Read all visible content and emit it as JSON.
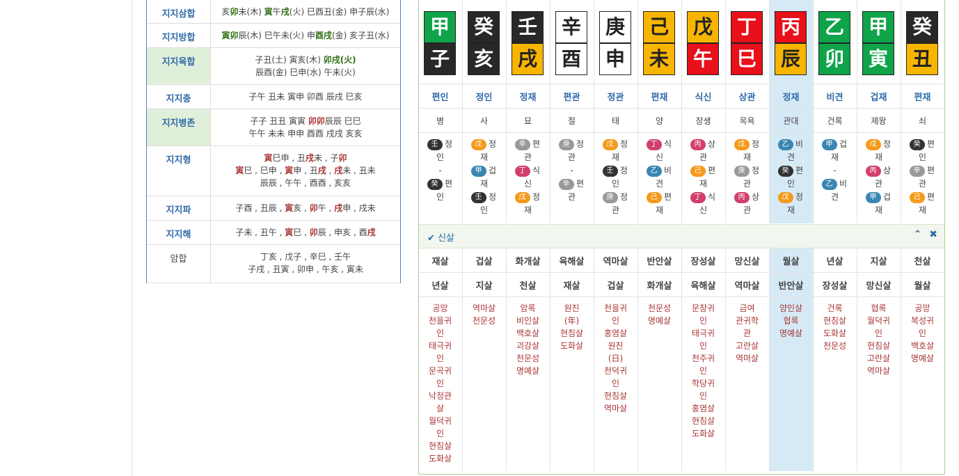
{
  "left": [
    {
      "label": "지지삼합",
      "style": "blue",
      "lines": [
        [
          [
            "亥",
            ""
          ],
          [
            "卯",
            "g"
          ],
          [
            "未(木) ",
            ""
          ],
          [
            "寅",
            "g"
          ],
          [
            "午",
            ""
          ],
          [
            "戌",
            "g"
          ],
          [
            "(火) 巳酉丑(金) 申子辰(水)",
            ""
          ]
        ]
      ]
    },
    {
      "label": "지지방합",
      "style": "blue",
      "lines": [
        [
          [
            "寅",
            "g"
          ],
          [
            "卯",
            "g"
          ],
          [
            "辰(木) 巳午未(火) 申",
            ""
          ],
          [
            "酉",
            "g"
          ],
          [
            "戌",
            "g"
          ],
          [
            "(金) 亥子丑(水)",
            ""
          ]
        ]
      ]
    },
    {
      "label": "지지육합",
      "style": "green",
      "lines": [
        [
          [
            "子丑(土) 寅亥(木) ",
            ""
          ],
          [
            "卯戌(火)",
            "g"
          ]
        ],
        [
          [
            "辰酉(金) 巳申(水) 午未(火)",
            ""
          ]
        ]
      ]
    },
    {
      "label": "지지충",
      "style": "blue",
      "lines": [
        [
          [
            "子午 丑未 寅申 卯酉 辰戌 巳亥",
            ""
          ]
        ]
      ]
    },
    {
      "label": "지지병존",
      "style": "green",
      "lines": [
        [
          [
            "子子 丑丑 寅寅 ",
            ""
          ],
          [
            "卯卯",
            "r"
          ],
          [
            "辰辰 巳巳",
            ""
          ]
        ],
        [
          [
            "午午 未未 申申 酉酉 戌戌 亥亥",
            ""
          ]
        ]
      ]
    },
    {
      "label": "지지형",
      "style": "blue",
      "lines": [
        [
          [
            "寅",
            "r"
          ],
          [
            "巳申 , 丑",
            ""
          ],
          [
            "戌",
            "r"
          ],
          [
            "未 , 子",
            ""
          ],
          [
            "卯",
            "r"
          ]
        ],
        [
          [
            "寅",
            "r"
          ],
          [
            "巳 , 巳申 , ",
            ""
          ],
          [
            "寅",
            "r"
          ],
          [
            "申 , 丑",
            ""
          ],
          [
            "戌",
            "r"
          ],
          [
            " , ",
            ""
          ],
          [
            "戌",
            "r"
          ],
          [
            "未 , 丑未",
            ""
          ]
        ],
        [
          [
            "辰辰 , 午午 , 酉酉 , 亥亥",
            ""
          ]
        ]
      ]
    },
    {
      "label": "지지파",
      "style": "blue",
      "lines": [
        [
          [
            "子酉 , 丑辰 , ",
            ""
          ],
          [
            "寅",
            "r"
          ],
          [
            "亥 , ",
            ""
          ],
          [
            "卯",
            "r"
          ],
          [
            "午 , ",
            ""
          ],
          [
            "戌",
            "r"
          ],
          [
            "申 , 戌未",
            ""
          ]
        ]
      ]
    },
    {
      "label": "지지해",
      "style": "blue",
      "lines": [
        [
          [
            "子未 , 丑午 , ",
            ""
          ],
          [
            "寅",
            "r"
          ],
          [
            "巳 , ",
            ""
          ],
          [
            "卯",
            "r"
          ],
          [
            "辰 , 申亥 , 酉",
            ""
          ],
          [
            "戌",
            "r"
          ]
        ]
      ]
    },
    {
      "label": "암합",
      "style": "plain",
      "lines": [
        [
          [
            "丁亥 , 戊子 , 辛巳 , 壬午",
            ""
          ]
        ],
        [
          [
            "子戌 , 丑寅 , 卯申 , 午亥 , 寅未",
            ""
          ]
        ]
      ]
    }
  ],
  "columns": [
    {
      "top": "甲",
      "topEl": "wood",
      "bot": "子",
      "botEl": "water",
      "tg": "편인",
      "stg": "병",
      "jj": [
        {
          "p": "壬",
          "pc": "water",
          "t": [
            "정",
            "인"
          ]
        },
        {
          "sep": "-"
        },
        {
          "p": "癸",
          "pc": "water",
          "t": [
            "편",
            "인"
          ]
        }
      ],
      "s1": "재살",
      "s2": "년살",
      "sl": [
        "공망",
        "천을귀",
        "인",
        "태극귀",
        "인",
        "문곡귀",
        "인",
        "낙정관",
        "살",
        "월덕귀",
        "인",
        "현침살",
        "도화살"
      ]
    },
    {
      "top": "癸",
      "topEl": "water",
      "bot": "亥",
      "botEl": "water",
      "tg": "정인",
      "stg": "사",
      "jj": [
        {
          "p": "戊",
          "pc": "earth",
          "t": [
            "정",
            "재"
          ]
        },
        {
          "p": "甲",
          "pc": "wood",
          "t": [
            "겁",
            "재"
          ]
        },
        {
          "p": "壬",
          "pc": "water",
          "t": [
            "정",
            "인"
          ]
        }
      ],
      "s1": "겁살",
      "s2": "지살",
      "sl": [
        "역마살",
        "천문성"
      ]
    },
    {
      "top": "壬",
      "topEl": "water",
      "bot": "戌",
      "botEl": "earth",
      "tg": "정재",
      "stg": "묘",
      "jj": [
        {
          "p": "辛",
          "pc": "metal",
          "t": [
            "편",
            "관"
          ]
        },
        {
          "p": "丁",
          "pc": "fire",
          "t": [
            "식",
            "신"
          ]
        },
        {
          "p": "戊",
          "pc": "earth",
          "t": [
            "정",
            "재"
          ]
        }
      ],
      "s1": "화개살",
      "s2": "천살",
      "sl": [
        "암록",
        "비인살",
        "백호살",
        "괴강살",
        "천문성",
        "명예살"
      ]
    },
    {
      "top": "辛",
      "topEl": "metal",
      "bot": "酉",
      "botEl": "metal",
      "tg": "편관",
      "stg": "절",
      "jj": [
        {
          "p": "庚",
          "pc": "metal",
          "t": [
            "정",
            "관"
          ]
        },
        {
          "sep": "-"
        },
        {
          "p": "辛",
          "pc": "metal",
          "t": [
            "편",
            "관"
          ]
        }
      ],
      "s1": "육해살",
      "s2": "재살",
      "sl": [
        "원진",
        "(年)",
        "현침살",
        "도화살"
      ]
    },
    {
      "top": "庚",
      "topEl": "metal",
      "bot": "申",
      "botEl": "metal",
      "tg": "정관",
      "stg": "태",
      "jj": [
        {
          "p": "戊",
          "pc": "earth",
          "t": [
            "정",
            "재"
          ]
        },
        {
          "p": "壬",
          "pc": "water",
          "t": [
            "정",
            "인"
          ]
        },
        {
          "p": "庚",
          "pc": "metal",
          "t": [
            "정",
            "관"
          ]
        }
      ],
      "s1": "역마살",
      "s2": "겁살",
      "sl": [
        "천을귀",
        "인",
        "홍염살",
        "원진",
        "(日)",
        "천덕귀",
        "인",
        "현침살",
        "역마살"
      ]
    },
    {
      "top": "己",
      "topEl": "earth",
      "bot": "未",
      "botEl": "earth",
      "tg": "편재",
      "stg": "양",
      "jj": [
        {
          "p": "丁",
          "pc": "fire",
          "t": [
            "식",
            "신"
          ]
        },
        {
          "p": "乙",
          "pc": "wood",
          "t": [
            "비",
            "견"
          ]
        },
        {
          "p": "己",
          "pc": "earth",
          "t": [
            "편",
            "재"
          ]
        }
      ],
      "s1": "반안살",
      "s2": "화개살",
      "sl": [
        "천문성",
        "명예살"
      ]
    },
    {
      "top": "戊",
      "topEl": "earth",
      "bot": "午",
      "botEl": "fire",
      "tg": "식신",
      "stg": "장생",
      "jj": [
        {
          "p": "丙",
          "pc": "fire",
          "t": [
            "상",
            "관"
          ]
        },
        {
          "p": "己",
          "pc": "earth",
          "t": [
            "편",
            "재"
          ]
        },
        {
          "p": "丁",
          "pc": "fire",
          "t": [
            "식",
            "신"
          ]
        }
      ],
      "s1": "장성살",
      "s2": "육해살",
      "sl": [
        "문창귀",
        "인",
        "태극귀",
        "인",
        "천주귀",
        "인",
        "학당귀",
        "인",
        "홍염살",
        "현침살",
        "도화살"
      ]
    },
    {
      "top": "丁",
      "topEl": "fire",
      "bot": "巳",
      "botEl": "fire",
      "tg": "상관",
      "stg": "목욕",
      "jj": [
        {
          "p": "戊",
          "pc": "earth",
          "t": [
            "정",
            "재"
          ]
        },
        {
          "p": "庚",
          "pc": "metal",
          "t": [
            "정",
            "관"
          ]
        },
        {
          "p": "丙",
          "pc": "fire",
          "t": [
            "상",
            "관"
          ]
        }
      ],
      "s1": "망신살",
      "s2": "역마살",
      "sl": [
        "금여",
        "관귀학",
        "관",
        "고란살",
        "역마살"
      ]
    },
    {
      "top": "丙",
      "topEl": "fire",
      "bot": "辰",
      "botEl": "earth",
      "tg": "정재",
      "stg": "관대",
      "hl": true,
      "jj": [
        {
          "p": "乙",
          "pc": "wood",
          "t": [
            "비",
            "견"
          ]
        },
        {
          "p": "癸",
          "pc": "water",
          "t": [
            "편",
            "인"
          ]
        },
        {
          "p": "戊",
          "pc": "earth",
          "t": [
            "정",
            "재"
          ]
        }
      ],
      "s1": "월살",
      "s2": "반안살",
      "sl": [
        "양인살",
        "협록",
        "명예살"
      ]
    },
    {
      "top": "乙",
      "topEl": "wood",
      "bot": "卯",
      "botEl": "wood",
      "tg": "비견",
      "stg": "건록",
      "jj": [
        {
          "p": "甲",
          "pc": "wood",
          "t": [
            "겁",
            "재"
          ]
        },
        {
          "sep": "-"
        },
        {
          "p": "乙",
          "pc": "wood",
          "t": [
            "비",
            "견"
          ]
        }
      ],
      "s1": "년살",
      "s2": "장성살",
      "sl": [
        "건록",
        "현침살",
        "도화살",
        "천문성"
      ]
    },
    {
      "top": "甲",
      "topEl": "wood",
      "bot": "寅",
      "botEl": "wood",
      "tg": "겁재",
      "stg": "제왕",
      "jj": [
        {
          "p": "戊",
          "pc": "earth",
          "t": [
            "정",
            "재"
          ]
        },
        {
          "p": "丙",
          "pc": "fire",
          "t": [
            "상",
            "관"
          ]
        },
        {
          "p": "甲",
          "pc": "wood",
          "t": [
            "겁",
            "재"
          ]
        }
      ],
      "s1": "지살",
      "s2": "망신살",
      "sl": [
        "협록",
        "월덕귀",
        "인",
        "현침살",
        "고란살",
        "역마살"
      ]
    },
    {
      "top": "癸",
      "topEl": "water",
      "bot": "丑",
      "botEl": "earth",
      "tg": "편재",
      "stg": "쇠",
      "jj": [
        {
          "p": "癸",
          "pc": "water",
          "t": [
            "편",
            "인"
          ]
        },
        {
          "p": "辛",
          "pc": "metal",
          "t": [
            "편",
            "관"
          ]
        },
        {
          "p": "己",
          "pc": "earth",
          "t": [
            "편",
            "재"
          ]
        }
      ],
      "s1": "천살",
      "s2": "월살",
      "sl": [
        "공망",
        "복성귀",
        "인",
        "백호살",
        "명예살"
      ]
    }
  ],
  "sinsal": {
    "title": "신살",
    "check": "✔",
    "up": "⌃",
    "close": "✖"
  }
}
